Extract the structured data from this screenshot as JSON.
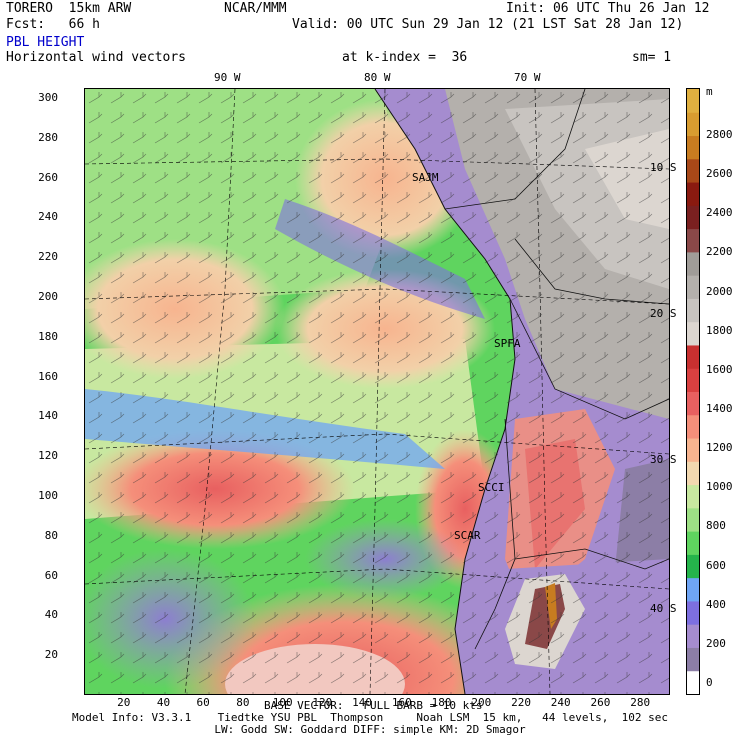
{
  "header": {
    "model": "TORERO  15km ARW",
    "center": "NCAR/MMM",
    "init": "Init: 06 UTC Thu 26 Jan 12",
    "fcst": "Fcst:   66 h",
    "valid": "Valid: 00 UTC Sun 29 Jan 12 (21 LST Sat 28 Jan 12)",
    "field": "PBL HEIGHT",
    "vectors": "Horizontal wind vectors",
    "kindex": "at k-index =  36",
    "smooth": "sm= 1"
  },
  "longitude_labels": [
    "90 W",
    "80 W",
    "70 W"
  ],
  "latitude_labels": [
    "10 S",
    "20 S",
    "30 S",
    "40 S"
  ],
  "place_labels": [
    "SAJM",
    "SPFA",
    "SCCI",
    "SCAR"
  ],
  "chart_data": {
    "type": "heatmap",
    "xlim": [
      0,
      295
    ],
    "ylim": [
      0,
      305
    ],
    "x_ticks": [
      20,
      40,
      60,
      80,
      100,
      120,
      140,
      160,
      180,
      200,
      220,
      240,
      260,
      280
    ],
    "y_ticks": [
      20,
      40,
      60,
      80,
      100,
      120,
      140,
      160,
      180,
      200,
      220,
      240,
      260,
      280,
      300
    ],
    "colorbar": {
      "unit": "m",
      "ticks": [
        0,
        200,
        400,
        600,
        800,
        1000,
        1200,
        1400,
        1600,
        1800,
        2000,
        2200,
        2400,
        2600,
        2800
      ],
      "colors": [
        "#ffffff",
        "#8c7ea6",
        "#a58ccf",
        "#7d6fe0",
        "#6fa5f5",
        "#25b44b",
        "#5fd45f",
        "#9ee085",
        "#c8e8a0",
        "#f2d8b0",
        "#f7b48f",
        "#f58f7a",
        "#e86060",
        "#d94040",
        "#c83030",
        "#dcd6d0",
        "#c8c4c0",
        "#b4b0ac",
        "#a09c98",
        "#8a4848",
        "#7a2020",
        "#8a1a10",
        "#a84818",
        "#c87c20",
        "#d89c30",
        "#e0b040"
      ]
    }
  },
  "footer": {
    "basevec": "BASE VECTOR:   FULL BARB = 10 kts",
    "line1": "Model Info: V3.3.1    Tiedtke YSU PBL  Thompson     Noah LSM  15 km,   44 levels,  102 sec",
    "line2": "LW: Godd SW: Goddard DIFF: simple KM: 2D Smagor"
  }
}
